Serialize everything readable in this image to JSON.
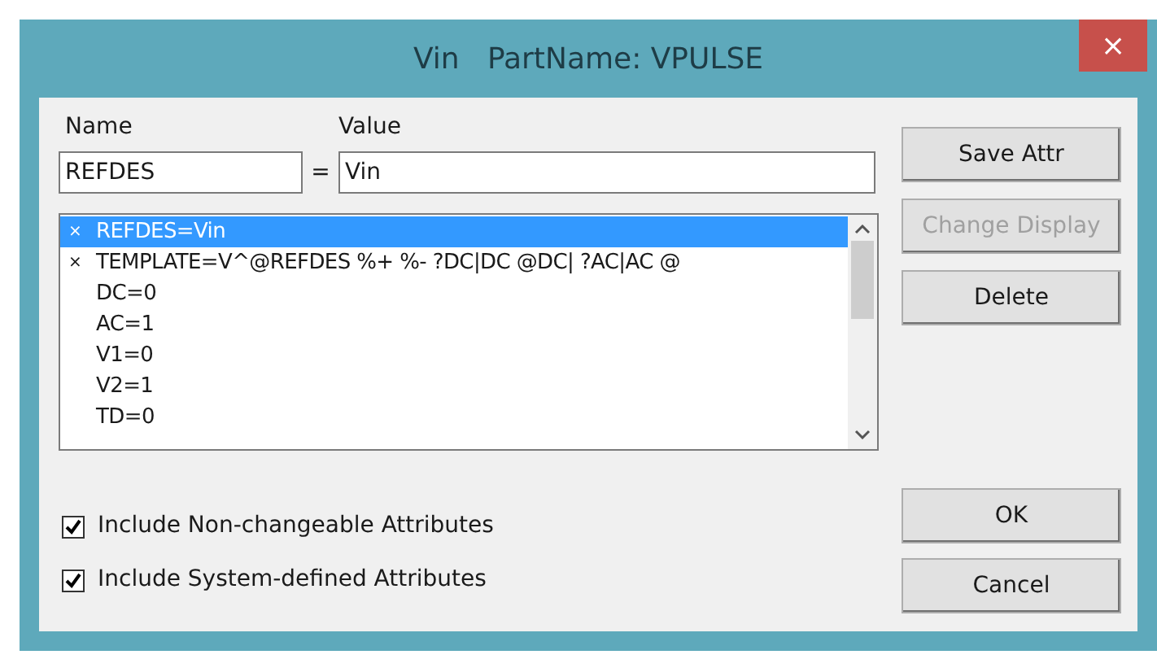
{
  "window": {
    "title": "Vin   PartName: VPULSE",
    "close": "×"
  },
  "name_field": {
    "label": "Name",
    "value": "REFDES"
  },
  "equals": "=",
  "value_field": {
    "label": "Value",
    "value": "Vin"
  },
  "attributes": [
    {
      "marker": "×",
      "text": "REFDES=Vin",
      "selected": true
    },
    {
      "marker": "×",
      "text": "TEMPLATE=V^@REFDES %+ %- ?DC|DC @DC| ?AC|AC @",
      "selected": false
    },
    {
      "text": "DC=0",
      "selected": false
    },
    {
      "text": "AC=1",
      "selected": false
    },
    {
      "text": "V1=0",
      "selected": false
    },
    {
      "text": "V2=1",
      "selected": false
    },
    {
      "text": "TD=0",
      "selected": false
    }
  ],
  "side_buttons": [
    {
      "label": "Save Attr",
      "disabled": false
    },
    {
      "label": "Change Display",
      "disabled": true
    },
    {
      "label": "Delete",
      "disabled": false
    }
  ],
  "options": [
    {
      "label": "Include Non-changeable Attributes",
      "checked": true
    },
    {
      "label": "Include System-defined Attributes",
      "checked": true
    }
  ],
  "dialog_buttons": [
    {
      "label": "OK"
    },
    {
      "label": "Cancel"
    }
  ]
}
